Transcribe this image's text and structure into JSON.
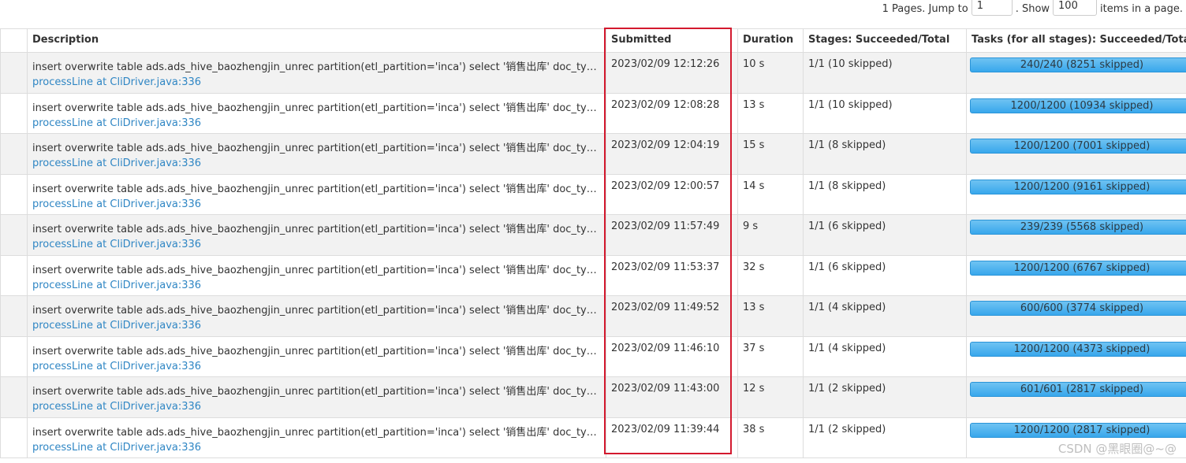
{
  "pager": {
    "pages_text": "1 Pages. Jump to",
    "jump_value": "1",
    "show_text": ". Show",
    "show_value": "100",
    "items_text": "items in a page."
  },
  "columns": {
    "description": "Description",
    "submitted": "Submitted",
    "duration": "Duration",
    "stages": "Stages: Succeeded/Total",
    "tasks": "Tasks (for all stages): Succeeded/Total"
  },
  "rows": [
    {
      "description": "insert overwrite table ads.ads_hive_baozhengjin_unrec partition(etl_partition='inca') select '销售出库' doc_type, -- 单...",
      "link": "processLine at CliDriver.java:336",
      "submitted": "2023/02/09 12:12:26",
      "duration": "10 s",
      "stages": "1/1 (10 skipped)",
      "tasks": "240/240 (8251 skipped)",
      "task_progress": 1.0
    },
    {
      "description": "insert overwrite table ads.ads_hive_baozhengjin_unrec partition(etl_partition='inca') select '销售出库' doc_type, -- 单...",
      "link": "processLine at CliDriver.java:336",
      "submitted": "2023/02/09 12:08:28",
      "duration": "13 s",
      "stages": "1/1 (10 skipped)",
      "tasks": "1200/1200 (10934 skipped)",
      "task_progress": 1.0
    },
    {
      "description": "insert overwrite table ads.ads_hive_baozhengjin_unrec partition(etl_partition='inca') select '销售出库' doc_type, -- 单...",
      "link": "processLine at CliDriver.java:336",
      "submitted": "2023/02/09 12:04:19",
      "duration": "15 s",
      "stages": "1/1 (8 skipped)",
      "tasks": "1200/1200 (7001 skipped)",
      "task_progress": 1.0
    },
    {
      "description": "insert overwrite table ads.ads_hive_baozhengjin_unrec partition(etl_partition='inca') select '销售出库' doc_type, -- 单...",
      "link": "processLine at CliDriver.java:336",
      "submitted": "2023/02/09 12:00:57",
      "duration": "14 s",
      "stages": "1/1 (8 skipped)",
      "tasks": "1200/1200 (9161 skipped)",
      "task_progress": 1.0
    },
    {
      "description": "insert overwrite table ads.ads_hive_baozhengjin_unrec partition(etl_partition='inca') select '销售出库' doc_type, -- 单...",
      "link": "processLine at CliDriver.java:336",
      "submitted": "2023/02/09 11:57:49",
      "duration": "9 s",
      "stages": "1/1 (6 skipped)",
      "tasks": "239/239 (5568 skipped)",
      "task_progress": 1.0
    },
    {
      "description": "insert overwrite table ads.ads_hive_baozhengjin_unrec partition(etl_partition='inca') select '销售出库' doc_type, -- 单...",
      "link": "processLine at CliDriver.java:336",
      "submitted": "2023/02/09 11:53:37",
      "duration": "32 s",
      "stages": "1/1 (6 skipped)",
      "tasks": "1200/1200 (6767 skipped)",
      "task_progress": 1.0
    },
    {
      "description": "insert overwrite table ads.ads_hive_baozhengjin_unrec partition(etl_partition='inca') select '销售出库' doc_type, -- 单...",
      "link": "processLine at CliDriver.java:336",
      "submitted": "2023/02/09 11:49:52",
      "duration": "13 s",
      "stages": "1/1 (4 skipped)",
      "tasks": "600/600 (3774 skipped)",
      "task_progress": 1.0
    },
    {
      "description": "insert overwrite table ads.ads_hive_baozhengjin_unrec partition(etl_partition='inca') select '销售出库' doc_type, -- 单...",
      "link": "processLine at CliDriver.java:336",
      "submitted": "2023/02/09 11:46:10",
      "duration": "37 s",
      "stages": "1/1 (4 skipped)",
      "tasks": "1200/1200 (4373 skipped)",
      "task_progress": 1.0
    },
    {
      "description": "insert overwrite table ads.ads_hive_baozhengjin_unrec partition(etl_partition='inca') select '销售出库' doc_type, -- 单...",
      "link": "processLine at CliDriver.java:336",
      "submitted": "2023/02/09 11:43:00",
      "duration": "12 s",
      "stages": "1/1 (2 skipped)",
      "tasks": "601/601 (2817 skipped)",
      "task_progress": 1.0
    },
    {
      "description": "insert overwrite table ads.ads_hive_baozhengjin_unrec partition(etl_partition='inca') select '销售出库' doc_type, -- 单...",
      "link": "processLine at CliDriver.java:336",
      "submitted": "2023/02/09 11:39:44",
      "duration": "38 s",
      "stages": "1/1 (2 skipped)",
      "tasks": "1200/1200 (2817 skipped)",
      "task_progress": 1.0
    }
  ],
  "watermark": "CSDN @黑眼圈@~@",
  "colors": {
    "link": "#2f86c4",
    "progress": "#38a7ec",
    "highlight": "#d3192e"
  }
}
